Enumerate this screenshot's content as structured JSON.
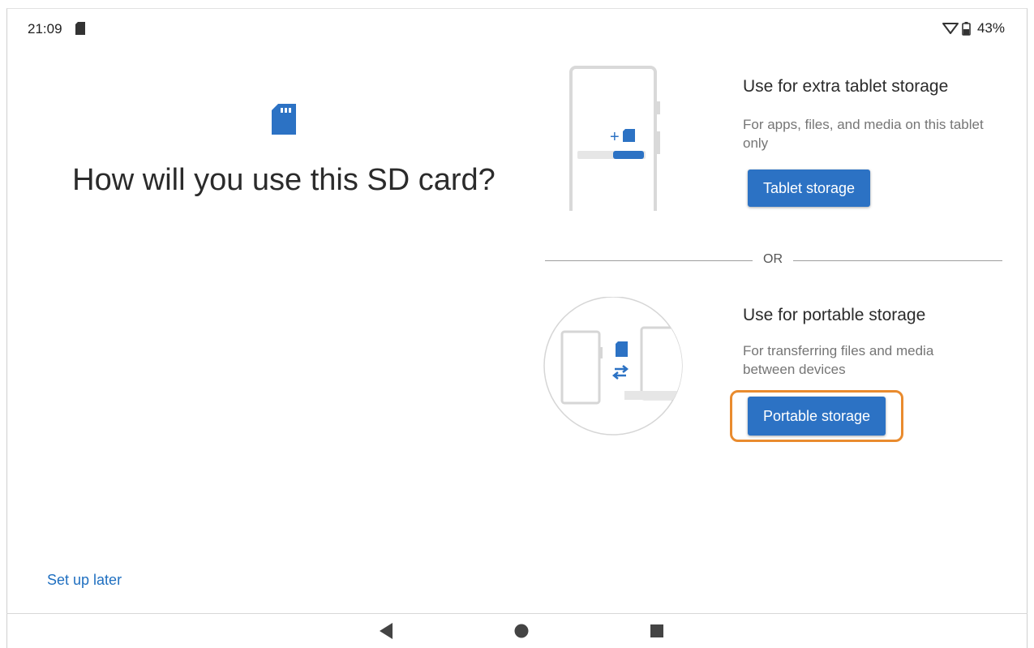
{
  "status_bar": {
    "time": "21:09",
    "battery_text": "43%",
    "icons": [
      "sd-card-icon",
      "wifi-icon",
      "battery-icon"
    ]
  },
  "header": {
    "icon": "sd-card-icon",
    "title": "How will you use this SD card?"
  },
  "options": [
    {
      "title": "Use for extra tablet storage",
      "description": "For apps, files, and media on this tablet only",
      "button_label": "Tablet storage"
    },
    {
      "title": "Use for portable storage",
      "description": "For transferring files and media between devices",
      "button_label": "Portable storage"
    }
  ],
  "divider": {
    "label": "OR"
  },
  "footer": {
    "setup_later": "Set up later"
  },
  "nav": {
    "icons": [
      "back-icon",
      "home-icon",
      "recents-icon"
    ]
  },
  "colors": {
    "accent": "#2c72c4",
    "highlight": "#e98b2e",
    "link": "#1f6fc0"
  }
}
